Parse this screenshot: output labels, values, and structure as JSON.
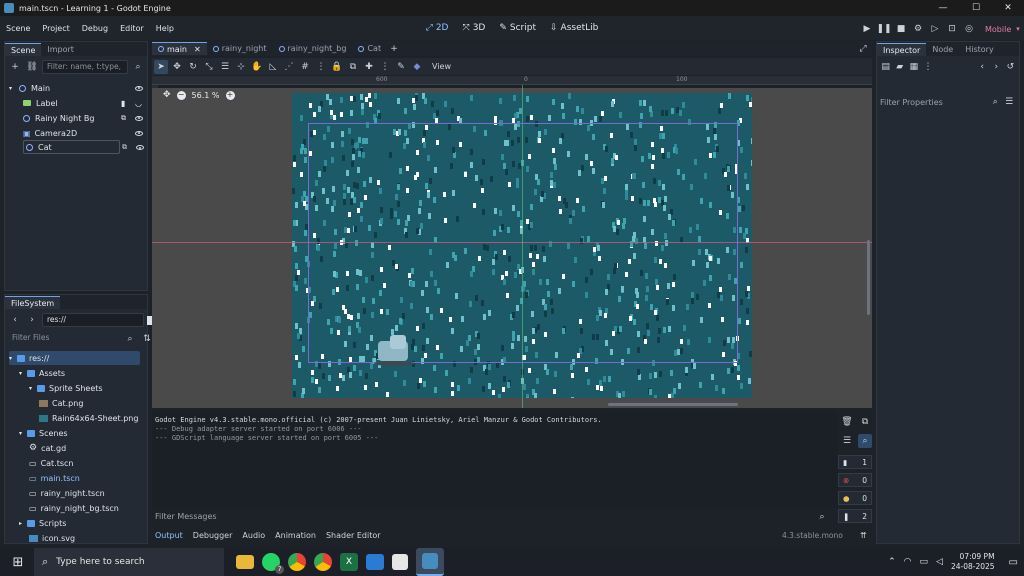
{
  "window": {
    "title": "main.tscn - Learning 1 - Godot Engine"
  },
  "menubar": {
    "items": [
      "Scene",
      "Project",
      "Debug",
      "Editor",
      "Help"
    ]
  },
  "workspaces": [
    {
      "label": "2D",
      "active": true
    },
    {
      "label": "3D",
      "active": false
    },
    {
      "label": "Script",
      "active": false
    },
    {
      "label": "AssetLib",
      "active": false
    }
  ],
  "renderer": "Mobile",
  "scene_dock": {
    "tabs": [
      "Scene",
      "Import"
    ],
    "filter_placeholder": "Filter: name, t:type,",
    "nodes": [
      {
        "name": "Main",
        "type": "node"
      },
      {
        "name": "Label",
        "type": "label"
      },
      {
        "name": "Rainy Night Bg",
        "type": "node"
      },
      {
        "name": "Camera2D",
        "type": "camera"
      },
      {
        "name": "Cat",
        "type": "node"
      }
    ]
  },
  "filesystem": {
    "tab": "FileSystem",
    "path": "res://",
    "filter_placeholder": "Filter Files",
    "items": [
      {
        "name": "res://",
        "kind": "folder"
      },
      {
        "name": "Assets",
        "kind": "folder"
      },
      {
        "name": "Sprite Sheets",
        "kind": "folder"
      },
      {
        "name": "Cat.png",
        "kind": "image"
      },
      {
        "name": "Rain64x64-Sheet.png",
        "kind": "image"
      },
      {
        "name": "Scenes",
        "kind": "folder"
      },
      {
        "name": "cat.gd",
        "kind": "script"
      },
      {
        "name": "Cat.tscn",
        "kind": "scene"
      },
      {
        "name": "main.tscn",
        "kind": "scene"
      },
      {
        "name": "rainy_night.tscn",
        "kind": "scene"
      },
      {
        "name": "rainy_night_bg.tscn",
        "kind": "scene"
      },
      {
        "name": "Scripts",
        "kind": "folder"
      },
      {
        "name": "icon.svg",
        "kind": "image"
      }
    ]
  },
  "editor_tabs": [
    {
      "label": "main",
      "active": true
    },
    {
      "label": "rainy_night",
      "active": false
    },
    {
      "label": "rainy_night_bg",
      "active": false
    },
    {
      "label": "Cat",
      "active": false
    }
  ],
  "toolbar": {
    "view_label": "View"
  },
  "viewport": {
    "zoom": "56.1 %",
    "ruler_labels": [
      "600",
      "0",
      "100"
    ]
  },
  "console": {
    "lines": [
      "Godot Engine v4.3.stable.mono.official (c) 2007-present Juan Linietsky, Ariel Manzur & Godot Contributors.",
      "--- Debug adapter server started on port 6006 ---",
      "--- GDScript language server started on port 6005 ---"
    ],
    "filter_placeholder": "Filter Messages",
    "counts": {
      "messages": "1",
      "errors": "0",
      "warnings": "0",
      "other": "2"
    }
  },
  "bottom_tabs": [
    "Output",
    "Debugger",
    "Audio",
    "Animation",
    "Shader Editor"
  ],
  "version": "4.3.stable.mono",
  "inspector": {
    "tabs": [
      "Inspector",
      "Node",
      "History"
    ],
    "filter_placeholder": "Filter Properties"
  },
  "taskbar": {
    "search_placeholder": "Type here to search",
    "time": "07:09 PM",
    "date": "24-08-2025",
    "whatsapp_badge": "7"
  },
  "colors": {
    "accent": "#6fa4e8",
    "rain_bg": "#1c5a68",
    "error": "#e05252",
    "warning": "#e6c44d"
  }
}
